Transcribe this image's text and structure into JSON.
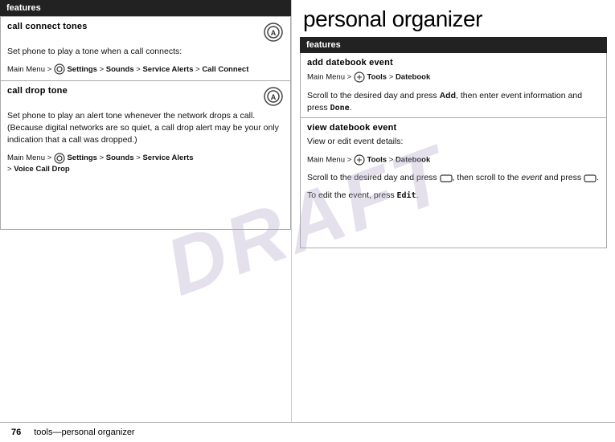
{
  "page": {
    "title": "personal organizer",
    "draft_watermark": "DRAFT",
    "footer": {
      "page_number": "76",
      "text": "tools—personal organizer"
    }
  },
  "left_column": {
    "header": "features",
    "sections": [
      {
        "id": "call-connect-tones",
        "title": "call connect tones",
        "has_icon": true,
        "body": "Set phone to play a tone when a call connects:",
        "path_parts": [
          "Main Menu",
          ">",
          "Settings",
          ">",
          "Sounds",
          ">",
          "Service Alerts",
          ">",
          "Call Connect"
        ],
        "path_bold": [
          false,
          false,
          true,
          false,
          true,
          false,
          true,
          false,
          true
        ]
      },
      {
        "id": "call-drop-tone",
        "title": "call drop tone",
        "has_icon": true,
        "body": "Set phone to play an alert tone whenever the network drops a call. (Because digital networks are so quiet, a call drop alert may be your only indication that a call was dropped.)",
        "path_parts": [
          "Main Menu",
          ">",
          "Settings",
          ">",
          "Sounds",
          ">",
          "Service Alerts",
          "\n>",
          "Voice Call Drop"
        ],
        "path_bold": [
          false,
          false,
          true,
          false,
          true,
          false,
          true,
          false,
          true,
          false,
          true
        ]
      }
    ]
  },
  "right_column": {
    "page_title": "personal organizer",
    "header": "features",
    "sections": [
      {
        "id": "add-datebook-event",
        "title": "add datebook event",
        "body1": "",
        "path_text": "Main Menu > Tools > Datebook",
        "body2": "Scroll to the desired day and press Add, then enter event information and press Done."
      },
      {
        "id": "view-datebook-event",
        "title": "view datebook event",
        "body1": "View or edit event details:",
        "path_text": "Main Menu > Tools > Datebook",
        "body2": "Scroll to the desired day and press",
        "body2b": ", then scroll to the event and press",
        "body3": "To edit the event, press Edit."
      }
    ]
  }
}
